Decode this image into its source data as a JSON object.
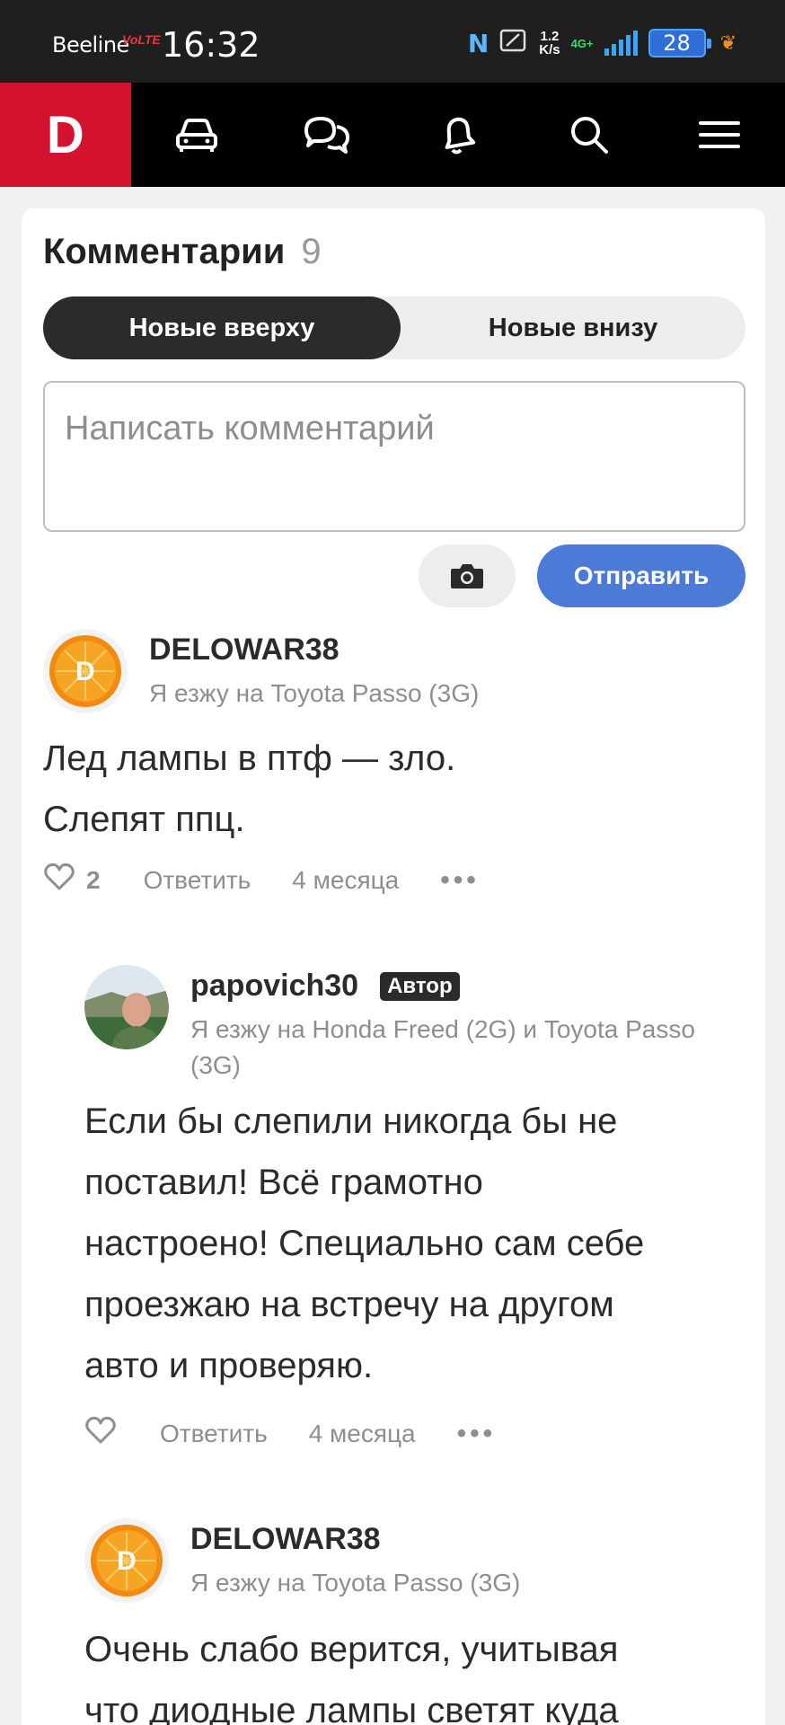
{
  "status_bar": {
    "carrier": "Beeline",
    "volte": "VoLTE",
    "time": "16:32",
    "nfc": "N",
    "net_speed_value": "1.2",
    "net_speed_unit": "K/s",
    "network": "4G+",
    "battery": "28"
  },
  "app_header": {
    "logo": "D",
    "nav": [
      "car-icon",
      "chat-icon",
      "bell-icon",
      "search-icon",
      "menu-icon"
    ]
  },
  "comments_section": {
    "title": "Комментарии",
    "count": "9",
    "sort_options": [
      "Новые вверху",
      "Новые внизу"
    ],
    "active_sort": "Новые вверху",
    "input_placeholder": "Написать комментарий",
    "send_label": "Отправить"
  },
  "comments": [
    {
      "author": "DELOWAR38",
      "badge": "",
      "drives": "Я езжу на Toyota Passo (3G)",
      "text_lines": [
        "Лед лампы в птф — зло.",
        "Слепят ппц."
      ],
      "likes": "2",
      "reply": "Ответить",
      "time": "4 месяца",
      "more": "•••"
    },
    {
      "author": "papovich30",
      "badge": "Автор",
      "drives_lines": [
        "Я езжу на Honda Freed (2G) и Toyota Passo",
        "(3G)"
      ],
      "text_lines": [
        "Если бы слепили никогда бы не",
        "поставил! Всё грамотно",
        "настроено! Специально сам себе",
        "проезжаю на встречу на другом",
        "авто и проверяю."
      ],
      "reply": "Ответить",
      "time": "4 месяца",
      "more": "•••"
    },
    {
      "author": "DELOWAR38",
      "drives": "Я езжу на Toyota Passo (3G)",
      "text_lines": [
        "Очень слабо верится, учитывая",
        "что диодные лампы светят куда"
      ]
    }
  ],
  "colors": {
    "brand_red": "#d3122f",
    "send_blue": "#4b7bd6",
    "toggle_dark": "#2b2b2b"
  }
}
